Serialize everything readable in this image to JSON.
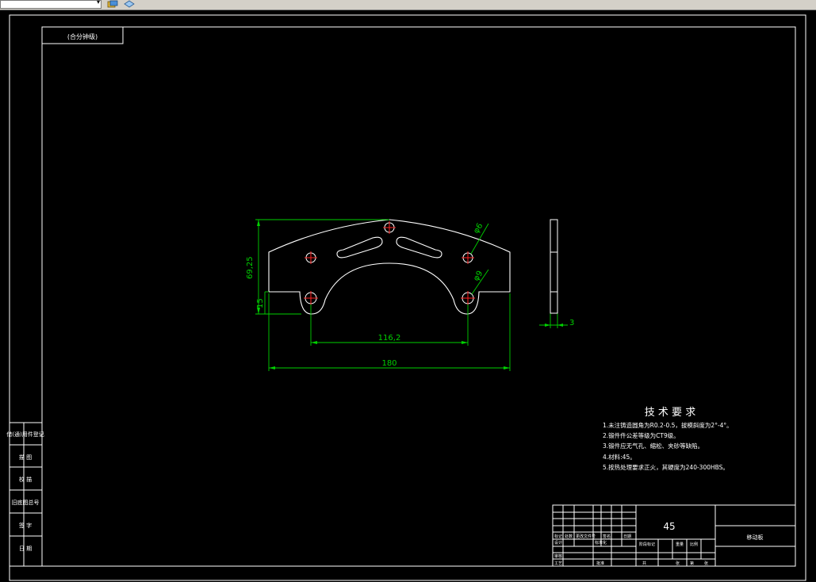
{
  "toolbar": {
    "layer_dropdown_value": "",
    "icons": [
      "layer-states-icon",
      "layer-properties-icon"
    ]
  },
  "drawing": {
    "top_label": "(合分钟级)",
    "dimensions": {
      "height_total": "69,25",
      "height_slot": "15",
      "hole_spacing": "116,2",
      "overall_width": "180",
      "hole_dia_small": "φ6",
      "hole_dia_large": "φ9",
      "thickness": "3"
    },
    "tech_requirements": {
      "title": "技 术 要 求",
      "items": [
        "1.未注铸造圆角为R0.2-0.5，拔模斜度为2°-4°。",
        "2.锻件件公差等级为CT9级。",
        "3.锻件应无气孔、缩松、夹砂等缺陷。",
        "4.材料:45。",
        "5.按热处理要求正火，其硬度为240-300HBS。"
      ]
    },
    "title_block": {
      "material": "45",
      "part_name": "移动板",
      "row_labels_1": [
        "标记",
        "处数",
        "更改文件号",
        "签名",
        "日期"
      ],
      "row_labels_2": [
        "设计",
        "",
        "标准化"
      ],
      "row_labels_3": [
        "审核"
      ],
      "row_labels_4": [
        "工艺",
        "",
        "批准"
      ],
      "stage_labels": [
        "阶段标记",
        "重量",
        "比例"
      ],
      "sheet_labels": [
        "共",
        "张",
        "第",
        "张"
      ]
    },
    "side_block": {
      "labels": [
        "借(通)用件登记",
        "描 图",
        "校 描",
        "旧底图总号",
        "签 字",
        "日 期"
      ]
    }
  }
}
